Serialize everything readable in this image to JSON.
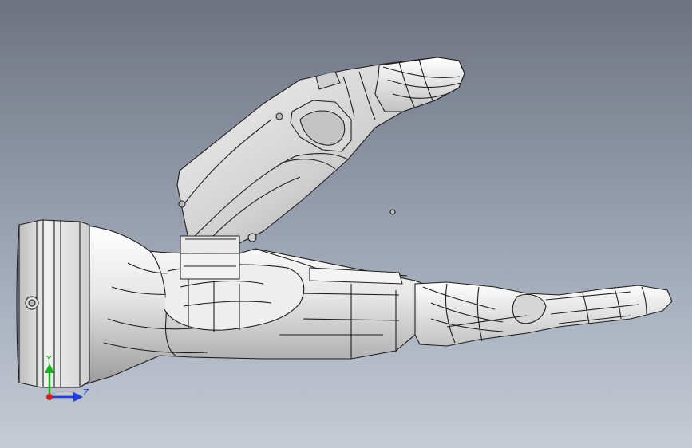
{
  "viewport": {
    "background_top": "#6d7381",
    "background_bottom": "#c6cbd3"
  },
  "model": {
    "subject": "prosthetic-hand-assembly",
    "shading": "shaded-with-edges",
    "body_color": "#e4e4e4",
    "edge_color": "#202020"
  },
  "triad": {
    "y_label": "Y",
    "z_label": "Z",
    "y_color": "#19b319",
    "z_color": "#1f3fd6",
    "x_color": "#d61f1f"
  }
}
